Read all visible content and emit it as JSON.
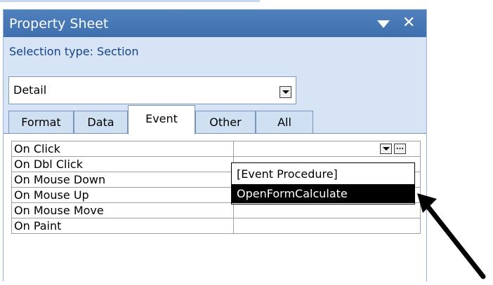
{
  "property_sheet": {
    "title": "Property Sheet",
    "selection_type": "Selection type:  Section",
    "object_combo_value": "Detail",
    "tabs": [
      "Format",
      "Data",
      "Event",
      "Other",
      "All"
    ],
    "active_tab": "Event",
    "properties": [
      {
        "name": "On Click",
        "value": ""
      },
      {
        "name": "On Dbl Click",
        "value": ""
      },
      {
        "name": "On Mouse Down",
        "value": ""
      },
      {
        "name": "On Mouse Up",
        "value": ""
      },
      {
        "name": "On Mouse Move",
        "value": ""
      },
      {
        "name": "On Paint",
        "value": ""
      }
    ],
    "dropdown_options": [
      "[Event Procedure]",
      "OpenFormCalculate"
    ],
    "selected_option": "OpenFormCalculate",
    "build_button_label": "..."
  },
  "colors": {
    "title_bar": "#4f81bd",
    "panel_bg": "#d6e4f5",
    "selection_text": "#15428b",
    "highlight": "#000000"
  }
}
